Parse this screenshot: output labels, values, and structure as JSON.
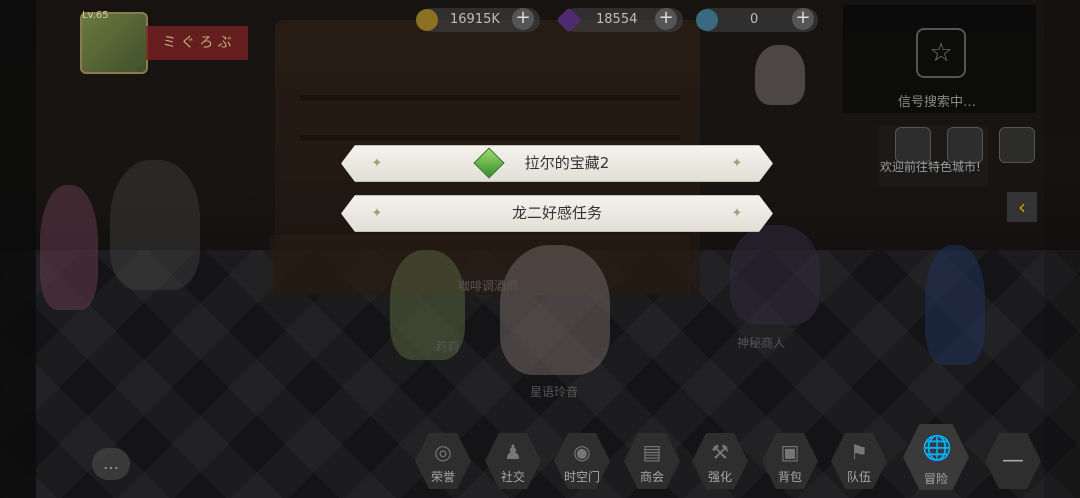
{
  "player": {
    "level": "Lv.65",
    "banner_text": "ミ ぐ ろ ぶ"
  },
  "currencies": [
    {
      "name": "gold",
      "icon": "coin-icon",
      "value": "16915K",
      "color": "#c9a227"
    },
    {
      "name": "gem",
      "icon": "purple-crystal-icon",
      "value": "18554",
      "color": "#7b3fb0"
    },
    {
      "name": "token",
      "icon": "swirl-coin-icon",
      "value": "0",
      "color": "#5a9fc0"
    }
  ],
  "signal": {
    "text": "信号搜索中…"
  },
  "notice": {
    "text": "欢迎前往特色城市!"
  },
  "dialog": {
    "options": [
      {
        "label": "拉尔的宝藏2",
        "icon": "green-gem-icon"
      },
      {
        "label": "龙二好感任务"
      }
    ]
  },
  "npcs": [
    {
      "label": "咖啡调酒师"
    },
    {
      "label": "神秘商人"
    }
  ],
  "characters": [
    {
      "label": "莉莉"
    },
    {
      "label": "星语玲音"
    }
  ],
  "nav": [
    {
      "label": "荣誉",
      "icon": "medal-icon"
    },
    {
      "label": "社交",
      "icon": "friends-icon"
    },
    {
      "label": "时空门",
      "icon": "portal-icon"
    },
    {
      "label": "商会",
      "icon": "shop-icon"
    },
    {
      "label": "强化",
      "icon": "hammer-icon"
    },
    {
      "label": "背包",
      "icon": "backpack-icon"
    },
    {
      "label": "队伍",
      "icon": "team-icon"
    },
    {
      "label": "冒险",
      "icon": "globe-icon"
    }
  ]
}
